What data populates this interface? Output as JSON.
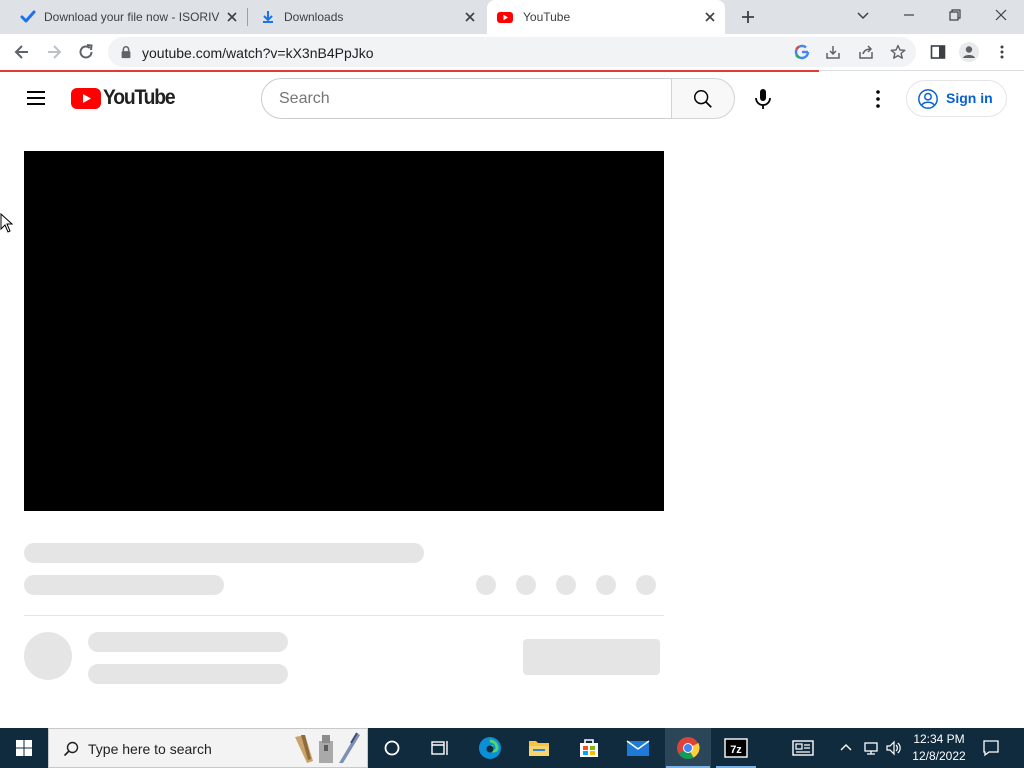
{
  "browser": {
    "tabs": [
      {
        "title": "Download your file now - ISORIV",
        "icon": "check-favicon-icon"
      },
      {
        "title": "Downloads",
        "icon": "download-favicon-icon"
      },
      {
        "title": "YouTube",
        "icon": "youtube-favicon-icon"
      }
    ],
    "url": "youtube.com/watch?v=kX3nB4PpJko",
    "page_load_progress": 0.8
  },
  "youtube": {
    "logo_text": "YouTube",
    "search_placeholder": "Search",
    "sign_in_label": "Sign in"
  },
  "taskbar": {
    "search_placeholder": "Type here to search",
    "time": "12:34 PM",
    "date": "12/8/2022"
  },
  "colors": {
    "youtube_red": "#ff0000",
    "link_blue": "#065fd4",
    "taskbar_bg": "#102a3e",
    "loading_bar": "#e53935"
  }
}
